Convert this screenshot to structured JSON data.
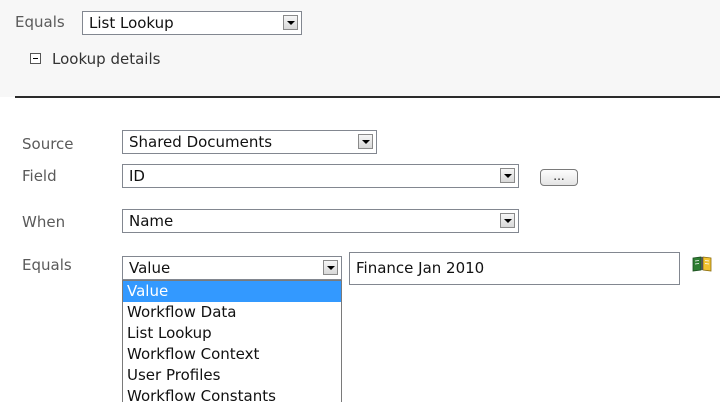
{
  "top": {
    "equals_label": "Equals",
    "equals_value": "List Lookup",
    "lookup_details_label": "Lookup details"
  },
  "form": {
    "source_label": "Source",
    "source_value": "Shared Documents",
    "field_label": "Field",
    "field_value": "ID",
    "ellipsis_label": "...",
    "when_label": "When",
    "when_value": "Name",
    "equals_label": "Equals",
    "equals_select_value": "Value",
    "equals_text_value": "Finance Jan 2010"
  },
  "dropdown": {
    "options": [
      "Value",
      "Workflow Data",
      "List Lookup",
      "Workflow Context",
      "User Profiles",
      "Workflow Constants"
    ],
    "selected_index": 0
  },
  "icons": {
    "lookup_book": "book-icon",
    "expand_collapse": "minus-icon",
    "dropdown": "chevron-down-icon"
  },
  "colors": {
    "selection": "#3399ff",
    "panel_background": "#f7f7f7"
  }
}
